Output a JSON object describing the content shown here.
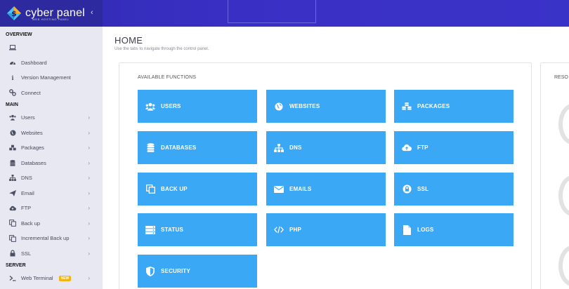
{
  "brand": {
    "name": "cyber panel",
    "tagline": "WEB HOSTING PANEL",
    "collapse": "‹"
  },
  "sidebar": {
    "overview_label": "OVERVIEW",
    "main_label": "MAIN",
    "server_label": "SERVER",
    "overview_items": [
      {
        "label": "",
        "icon": "laptop-icon"
      },
      {
        "label": "Dashboard",
        "icon": "dashboard-icon"
      },
      {
        "label": "Version Management",
        "icon": "info-icon"
      },
      {
        "label": "Connect",
        "icon": "link-icon"
      }
    ],
    "main_items": [
      {
        "label": "Users",
        "icon": "users-icon"
      },
      {
        "label": "Websites",
        "icon": "globe-icon"
      },
      {
        "label": "Packages",
        "icon": "cubes-icon"
      },
      {
        "label": "Databases",
        "icon": "database-icon"
      },
      {
        "label": "DNS",
        "icon": "sitemap-icon"
      },
      {
        "label": "Email",
        "icon": "paper-plane-icon"
      },
      {
        "label": "FTP",
        "icon": "cloud-upload-icon"
      },
      {
        "label": "Back up",
        "icon": "copy-icon"
      },
      {
        "label": "Incremental Back up",
        "icon": "copy-icon"
      },
      {
        "label": "SSL",
        "icon": "lock-icon"
      }
    ],
    "server_items": [
      {
        "label": "Web Terminal",
        "icon": "terminal-icon",
        "badge": "NEW"
      }
    ],
    "chevron": "›"
  },
  "main": {
    "title": "HOME",
    "subtitle": "Use the tabs to navigate through the control panel.",
    "panel_title": "AVAILABLE FUNCTIONS",
    "functions": [
      {
        "label": "USERS",
        "icon": "users-icon"
      },
      {
        "label": "WEBSITES",
        "icon": "globe-icon"
      },
      {
        "label": "PACKAGES",
        "icon": "cubes-icon"
      },
      {
        "label": "DATABASES",
        "icon": "database-icon"
      },
      {
        "label": "DNS",
        "icon": "sitemap-icon"
      },
      {
        "label": "FTP",
        "icon": "cloud-upload-icon"
      },
      {
        "label": "BACK UP",
        "icon": "copy-icon"
      },
      {
        "label": "EMAILS",
        "icon": "envelope-icon"
      },
      {
        "label": "SSL",
        "icon": "lock-icon"
      },
      {
        "label": "STATUS",
        "icon": "server-icon"
      },
      {
        "label": "PHP",
        "icon": "code-icon"
      },
      {
        "label": "LOGS",
        "icon": "file-icon"
      },
      {
        "label": "SECURITY",
        "icon": "shield-icon"
      }
    ],
    "resources_label": "RESO"
  },
  "colors": {
    "header": "#2f2bb0",
    "sidebar": "#e8e8f3",
    "button": "#3ba8f5",
    "badge": "#f3b417"
  }
}
